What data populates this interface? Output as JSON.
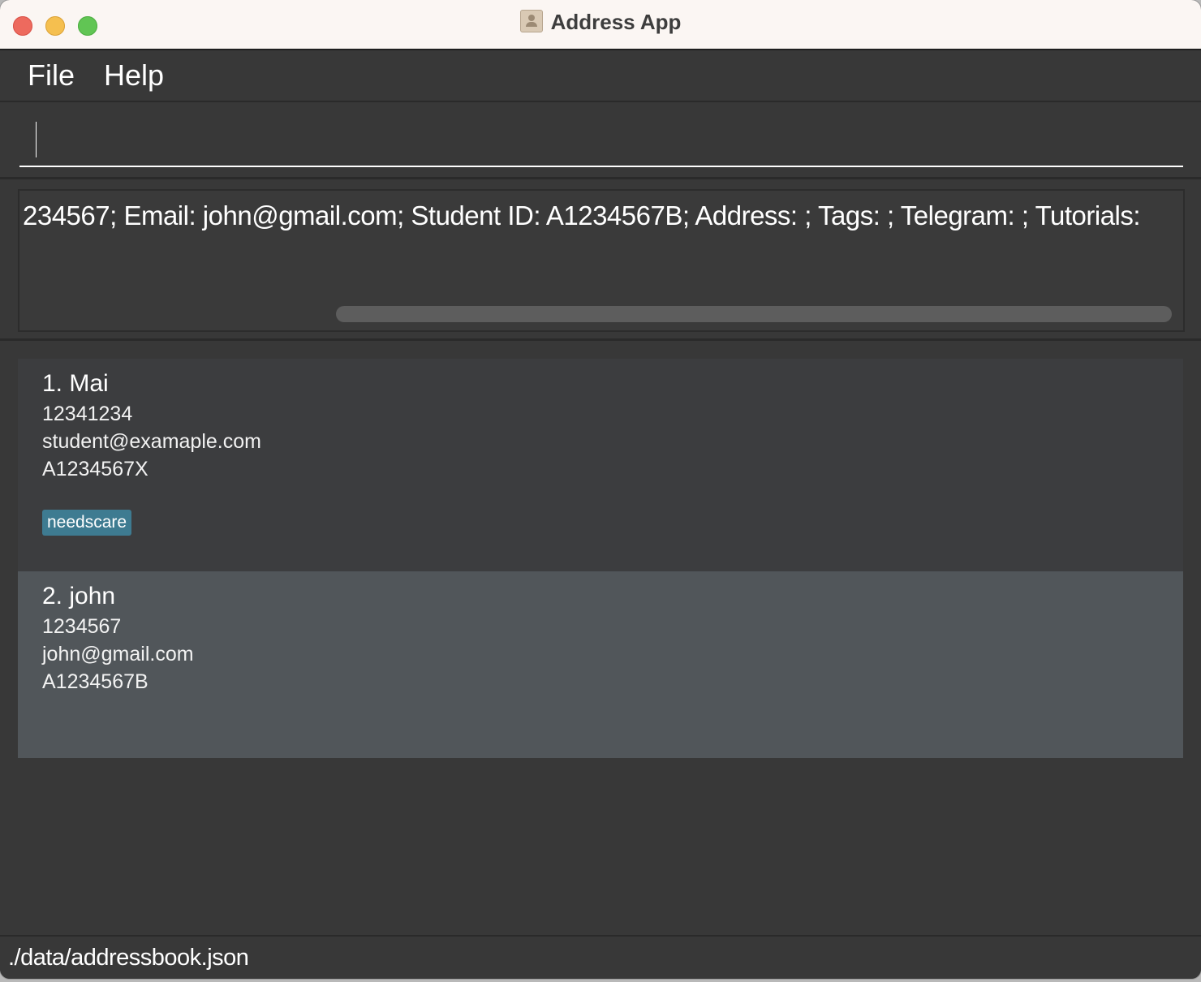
{
  "window": {
    "title": "Address App"
  },
  "menu": {
    "file": "File",
    "help": "Help"
  },
  "command": {
    "value": ""
  },
  "result": {
    "text": "234567; Email: john@gmail.com; Student ID: A1234567B; Address: ; Tags: ; Telegram: ; Tutorials:"
  },
  "persons": [
    {
      "name": "1. Mai",
      "phone": "12341234",
      "email": "student@examaple.com",
      "student_id": "A1234567X",
      "tags": [
        "needscare"
      ]
    },
    {
      "name": "2. john",
      "phone": "1234567",
      "email": "john@gmail.com",
      "student_id": "A1234567B",
      "tags": []
    }
  ],
  "status": {
    "file_path": "./data/addressbook.json"
  },
  "colors": {
    "tag_bg": "#3e7b91",
    "selected_card_bg": "#51565a",
    "background": "#383838"
  }
}
